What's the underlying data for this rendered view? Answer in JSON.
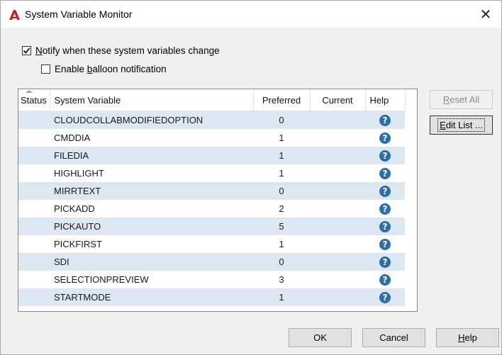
{
  "window": {
    "title": "System Variable Monitor",
    "close_glyph": "✕"
  },
  "options": {
    "notify": {
      "label_pre": "",
      "label_access": "N",
      "label_post": "otify when these system variables change",
      "checked": true
    },
    "balloon": {
      "label_pre": "Enable ",
      "label_access": "b",
      "label_post": "alloon notification",
      "checked": false
    }
  },
  "grid": {
    "columns": [
      "Status",
      "System Variable",
      "Preferred",
      "Current",
      "Help"
    ],
    "rows": [
      {
        "name": "CLOUDCOLLABMODIFIEDOPTION",
        "preferred": "0",
        "current": ""
      },
      {
        "name": "CMDDIA",
        "preferred": "1",
        "current": ""
      },
      {
        "name": "FILEDIA",
        "preferred": "1",
        "current": ""
      },
      {
        "name": "HIGHLIGHT",
        "preferred": "1",
        "current": ""
      },
      {
        "name": "MIRRTEXT",
        "preferred": "0",
        "current": ""
      },
      {
        "name": "PICKADD",
        "preferred": "2",
        "current": ""
      },
      {
        "name": "PICKAUTO",
        "preferred": "5",
        "current": ""
      },
      {
        "name": "PICKFIRST",
        "preferred": "1",
        "current": ""
      },
      {
        "name": "SDI",
        "preferred": "0",
        "current": ""
      },
      {
        "name": "SELECTIONPREVIEW",
        "preferred": "3",
        "current": ""
      },
      {
        "name": "STARTMODE",
        "preferred": "1",
        "current": ""
      }
    ]
  },
  "buttons": {
    "reset_all": {
      "pre": "",
      "access": "R",
      "post": "eset All",
      "enabled": false
    },
    "edit_list": {
      "pre": "",
      "access": "E",
      "post": "dit List ...",
      "enabled": true
    },
    "ok": {
      "label": "OK"
    },
    "cancel": {
      "label": "Cancel"
    },
    "help": {
      "pre": "",
      "access": "H",
      "post": "elp"
    }
  },
  "colors": {
    "accent_red": "#cc1f1f",
    "help_icon": "#2e6ea6",
    "row_alt": "#dde7f2"
  },
  "icons": {
    "app": "autocad-logo-icon",
    "help": "question-mark-icon",
    "check": "checkmark-icon"
  }
}
